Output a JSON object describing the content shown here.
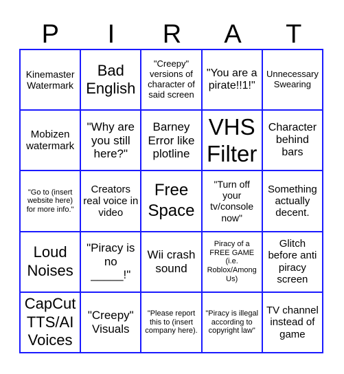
{
  "header": {
    "letters": [
      "P",
      "I",
      "R",
      "A",
      "T"
    ]
  },
  "board": {
    "border_color": "#1a1aff",
    "rows": [
      [
        "Kinemaster Watermark",
        "Bad English",
        "\"Creepy\" versions of character of said screen",
        "\"You are a pirate!!1!\"",
        "Unnecessary Swearing"
      ],
      [
        "Mobizen watermark",
        "\"Why are you still here?\"",
        "Barney Error like plotline",
        "VHS Filter",
        "Character behind bars"
      ],
      [
        "\"Go to (insert website here) for more info.\"",
        "Creators real voice in video",
        "Free Space",
        "\"Turn off your tv/console now\"",
        "Something actually decent."
      ],
      [
        "Loud Noises",
        "\"Piracy is no _____!\"",
        "Wii crash sound",
        "Piracy of a FREE GAME (i.e. Roblox/Among Us)",
        "Glitch before anti piracy screen"
      ],
      [
        "CapCut TTS/AI Voices",
        "\"Creepy\" Visuals",
        "\"Please report this to (insert company here).",
        "\"Piracy is illegal according to copyright law\"",
        "TV channel instead of game"
      ]
    ]
  }
}
